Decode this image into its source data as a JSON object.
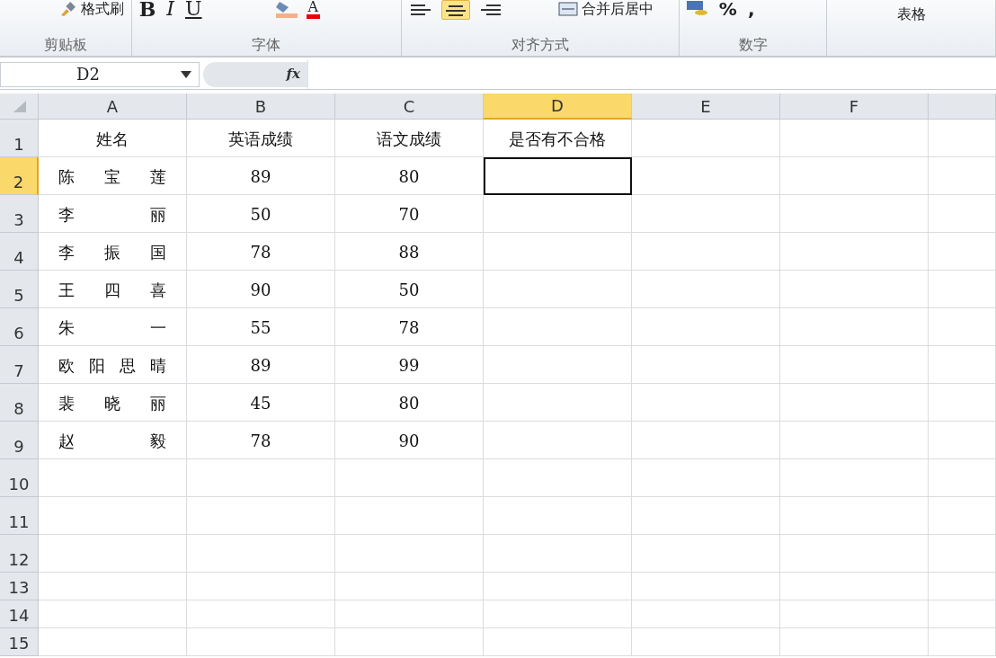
{
  "ribbon": {
    "groups": [
      {
        "label": "剪贴板",
        "kind": "clipboard",
        "format_painter": "格式刷"
      },
      {
        "label": "字体",
        "kind": "font",
        "styles": [
          "B",
          "I",
          "U"
        ],
        "font_color": "A"
      },
      {
        "label": "对齐方式",
        "kind": "align",
        "aligns": [
          {
            "kind": "left",
            "selected": false
          },
          {
            "kind": "center",
            "selected": true
          },
          {
            "kind": "right",
            "selected": false
          }
        ],
        "merge": "合并后居中"
      },
      {
        "label": "数字",
        "kind": "number",
        "symbols": [
          "%",
          ","
        ]
      },
      {
        "kind": "styles",
        "table_format": "表格"
      }
    ]
  },
  "formula_bar": {
    "name_box": "D2",
    "fx": "fx"
  },
  "sheet": {
    "columns": [
      {
        "label": "A",
        "selected": false
      },
      {
        "label": "B",
        "selected": false
      },
      {
        "label": "C",
        "selected": false
      },
      {
        "label": "D",
        "selected": true
      },
      {
        "label": "E",
        "selected": false
      },
      {
        "label": "F",
        "selected": false
      }
    ],
    "rows": [
      {
        "label": "1",
        "selected": false,
        "cells": [
          "姓名",
          "英语成绩",
          "语文成绩",
          "是否有不合格"
        ]
      },
      {
        "label": "2",
        "selected": true,
        "cells": [
          "陈宝莲",
          "89",
          "80"
        ]
      },
      {
        "label": "3",
        "selected": false,
        "cells": [
          "李丽",
          "50",
          "70"
        ]
      },
      {
        "label": "4",
        "selected": false,
        "cells": [
          "李振国",
          "78",
          "88"
        ]
      },
      {
        "label": "5",
        "selected": false,
        "cells": [
          "王四喜",
          "90",
          "50"
        ]
      },
      {
        "label": "6",
        "selected": false,
        "cells": [
          "朱一",
          "55",
          "78"
        ]
      },
      {
        "label": "7",
        "selected": false,
        "cells": [
          "欧阳思晴",
          "89",
          "99"
        ]
      },
      {
        "label": "8",
        "selected": false,
        "cells": [
          "裴晓丽",
          "45",
          "80"
        ]
      },
      {
        "label": "9",
        "selected": false,
        "cells": [
          "赵毅",
          "78",
          "90"
        ]
      },
      {
        "label": "10",
        "selected": false,
        "cells": []
      },
      {
        "label": "11",
        "selected": false,
        "cells": []
      },
      {
        "label": "12",
        "selected": false,
        "cells": []
      },
      {
        "label": "13",
        "selected": false,
        "cells": []
      },
      {
        "label": "14",
        "selected": false,
        "cells": []
      },
      {
        "label": "15",
        "selected": false,
        "cells": []
      }
    ]
  }
}
